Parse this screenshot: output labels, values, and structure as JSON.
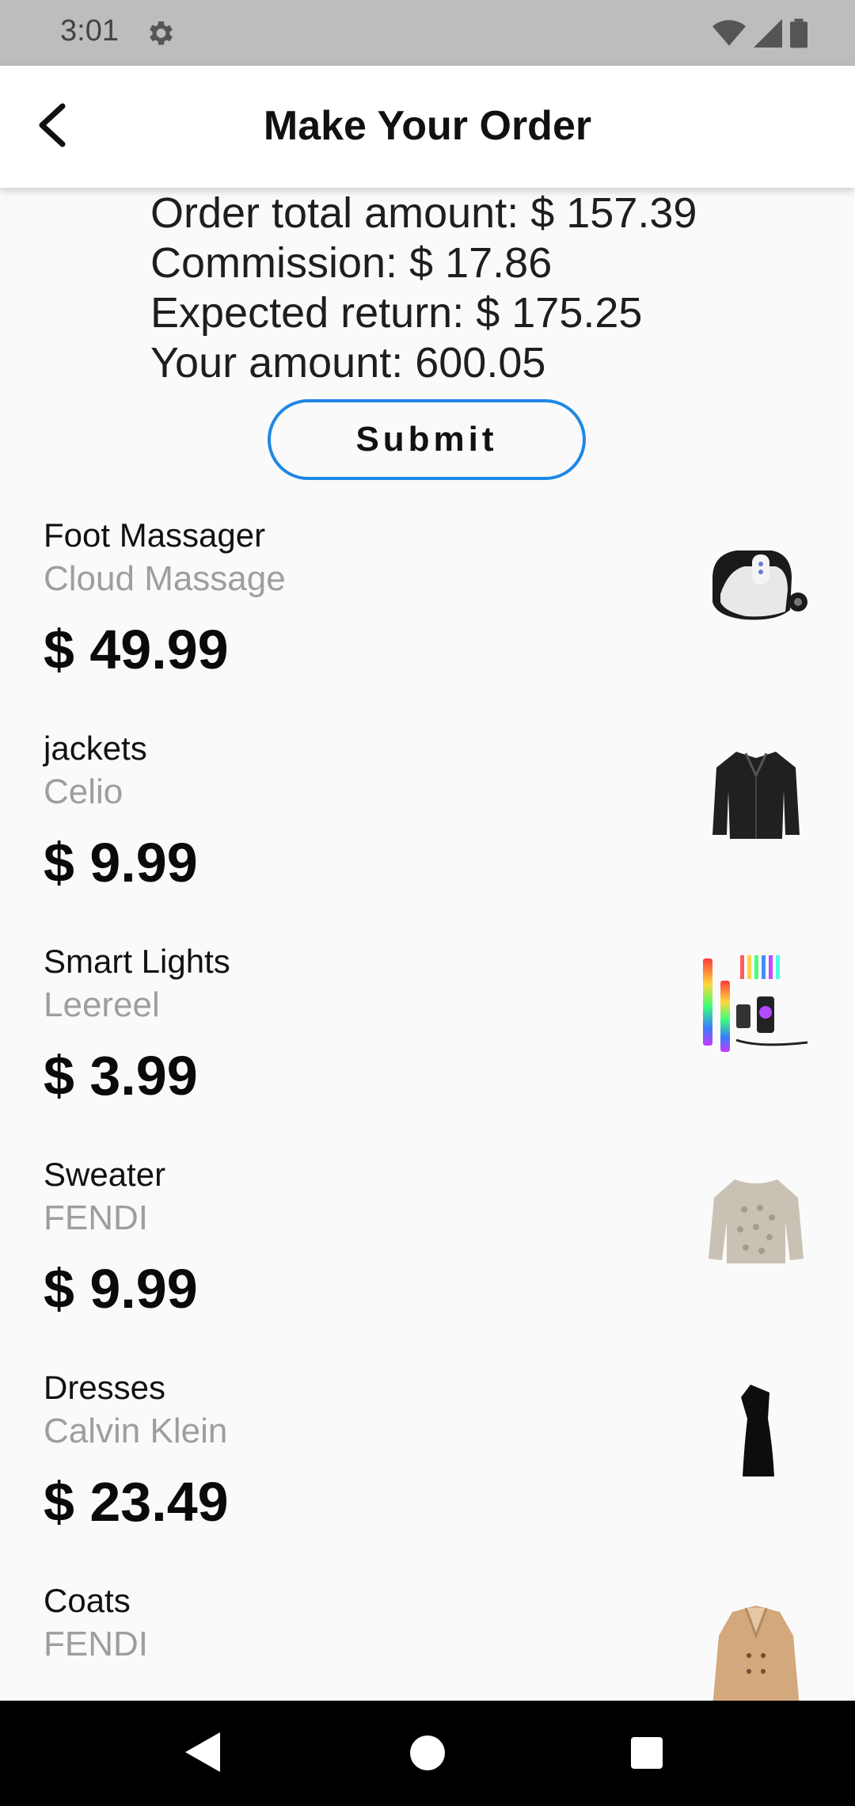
{
  "status_bar": {
    "time": "3:01",
    "icons": [
      "gear-icon",
      "wifi-icon",
      "signal-icon",
      "battery-icon"
    ]
  },
  "app_bar": {
    "title": "Make Your Order",
    "back_icon": "back-arrow-icon"
  },
  "summary": {
    "order_total": "Order total amount: $ 157.39",
    "commission": "Commission: $ 17.86",
    "expected_return": "Expected return: $ 175.25",
    "your_amount": "Your amount: 600.05"
  },
  "submit_label": "Submit",
  "products": [
    {
      "name": "Foot Massager",
      "brand": "Cloud Massage",
      "price": "$ 49.99",
      "image": "foot-massager-image"
    },
    {
      "name": "jackets",
      "brand": "Celio",
      "price": "$ 9.99",
      "image": "leather-jacket-image"
    },
    {
      "name": "Smart Lights",
      "brand": "Leereel",
      "price": "$ 3.99",
      "image": "smart-lights-image"
    },
    {
      "name": "Sweater",
      "brand": "FENDI",
      "price": "$ 9.99",
      "image": "sweater-image"
    },
    {
      "name": "Dresses",
      "brand": "Calvin Klein",
      "price": "$ 23.49",
      "image": "dress-image"
    },
    {
      "name": "Coats",
      "brand": "FENDI",
      "price": "",
      "image": "coat-image"
    }
  ],
  "colors": {
    "accent": "#1e88e5",
    "status_bar": "#bdbdbd",
    "background": "#fafafa",
    "brand_text": "#9e9e9e"
  },
  "nav_bar": {
    "icons": [
      "nav-back-icon",
      "nav-home-icon",
      "nav-recents-icon"
    ]
  }
}
